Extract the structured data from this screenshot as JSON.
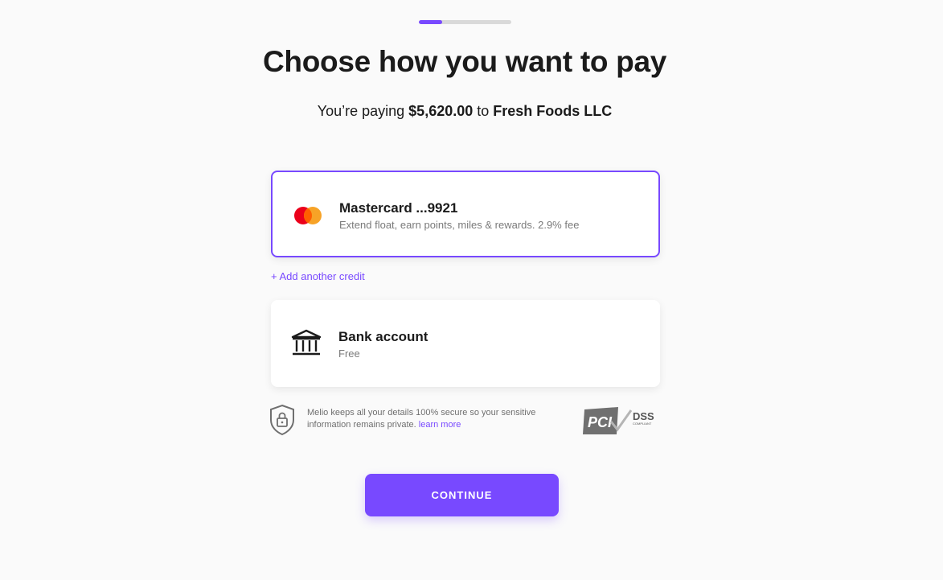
{
  "progress": {
    "value": 0.25
  },
  "header": {
    "title": "Choose how you want to pay",
    "subtitle_prefix": "You’re paying ",
    "amount": "$5,620.00",
    "subtitle_middle": " to ",
    "payee": "Fresh Foods LLC"
  },
  "payment_methods": {
    "credit": {
      "icon": "mastercard-icon",
      "title": "Mastercard ...9921",
      "description": "Extend float, earn points, miles & rewards. 2.9% fee",
      "selected": true
    },
    "add_credit_label": "+ Add another credit",
    "bank": {
      "icon": "bank-icon",
      "title": "Bank account",
      "description": "Free",
      "selected": false
    }
  },
  "security": {
    "icon": "shield-lock-icon",
    "text": "Melio keeps all your details 100% secure so your sensitive information remains private. ",
    "link": "learn more",
    "badge_text_1": "PCI",
    "badge_text_2": "DSS",
    "badge_text_3": "COMPLIANT"
  },
  "actions": {
    "continue_label": "CONTINUE"
  },
  "colors": {
    "accent": "#7849ff",
    "mastercard_red": "#eb001b",
    "mastercard_orange": "#f79e1b"
  }
}
